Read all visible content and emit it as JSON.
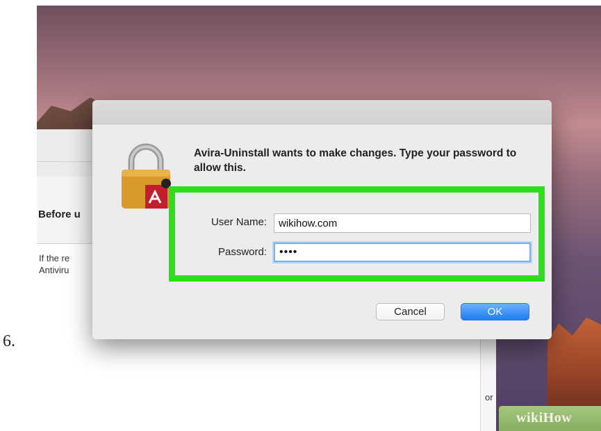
{
  "step": {
    "number": "6."
  },
  "background_window": {
    "heading": "Before u",
    "text_line_1": "If the re",
    "text_line_2": "Antiviru",
    "right_text": "or"
  },
  "dialog": {
    "message": "Avira-Uninstall wants to make changes. Type your password to allow this.",
    "lock_icon": "padlock-icon",
    "username": {
      "label": "User Name:",
      "value": "wikihow.com"
    },
    "password": {
      "label": "Password:",
      "value": "••••"
    },
    "buttons": {
      "cancel": "Cancel",
      "ok": "OK"
    },
    "highlight_color": "#2bdf1a",
    "ok_color": "#1f7cf0"
  },
  "watermark": {
    "text": "wikiHow"
  }
}
